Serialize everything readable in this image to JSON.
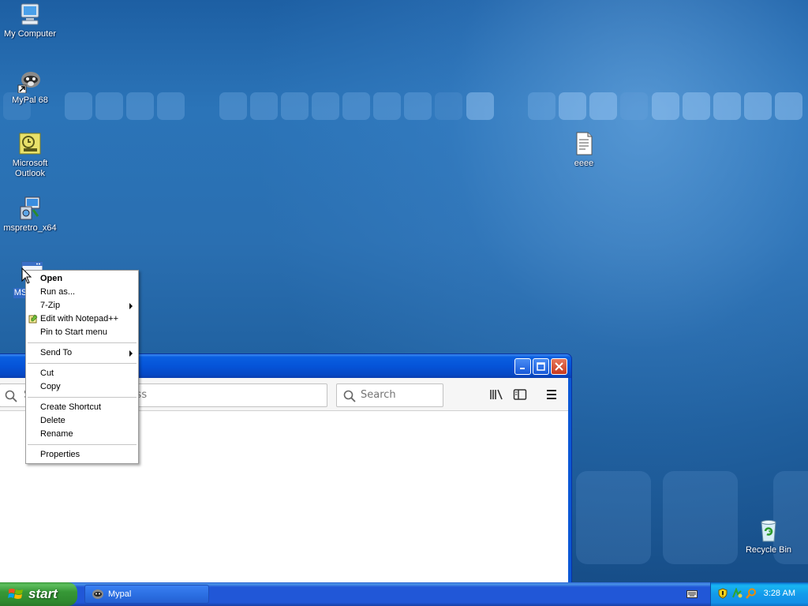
{
  "desktop": {
    "icons": [
      {
        "label": "My Computer",
        "icon": "my-computer-icon"
      },
      {
        "label": "MyPal 68",
        "icon": "mypal-icon"
      },
      {
        "label": "Microsoft Outlook",
        "icon": "outlook-icon"
      },
      {
        "label": "mspretro_x64",
        "icon": "installer-icon"
      },
      {
        "label": "MS",
        "icon": "application-icon"
      },
      {
        "label": "eeee",
        "icon": "text-file-icon"
      },
      {
        "label": "Recycle Bin",
        "icon": "recycle-bin-icon"
      }
    ]
  },
  "context_menu": {
    "items": [
      {
        "label": "Open",
        "bold": true
      },
      {
        "label": "Run as..."
      },
      {
        "label": "7-Zip",
        "submenu": true
      },
      {
        "label": "Edit with Notepad++",
        "icon": "notepadpp-icon"
      },
      {
        "label": "Pin to Start menu"
      },
      {
        "label": "Send To",
        "submenu": true
      },
      {
        "label": "Cut"
      },
      {
        "label": "Copy"
      },
      {
        "label": "Create Shortcut"
      },
      {
        "label": "Delete"
      },
      {
        "label": "Rename"
      },
      {
        "label": "Properties"
      }
    ]
  },
  "browser": {
    "address_placeholder": "Search or enter address",
    "search_placeholder": "Search"
  },
  "taskbar": {
    "start_label": "start",
    "task_label": "Mypal",
    "clock": "3:28 AM"
  }
}
